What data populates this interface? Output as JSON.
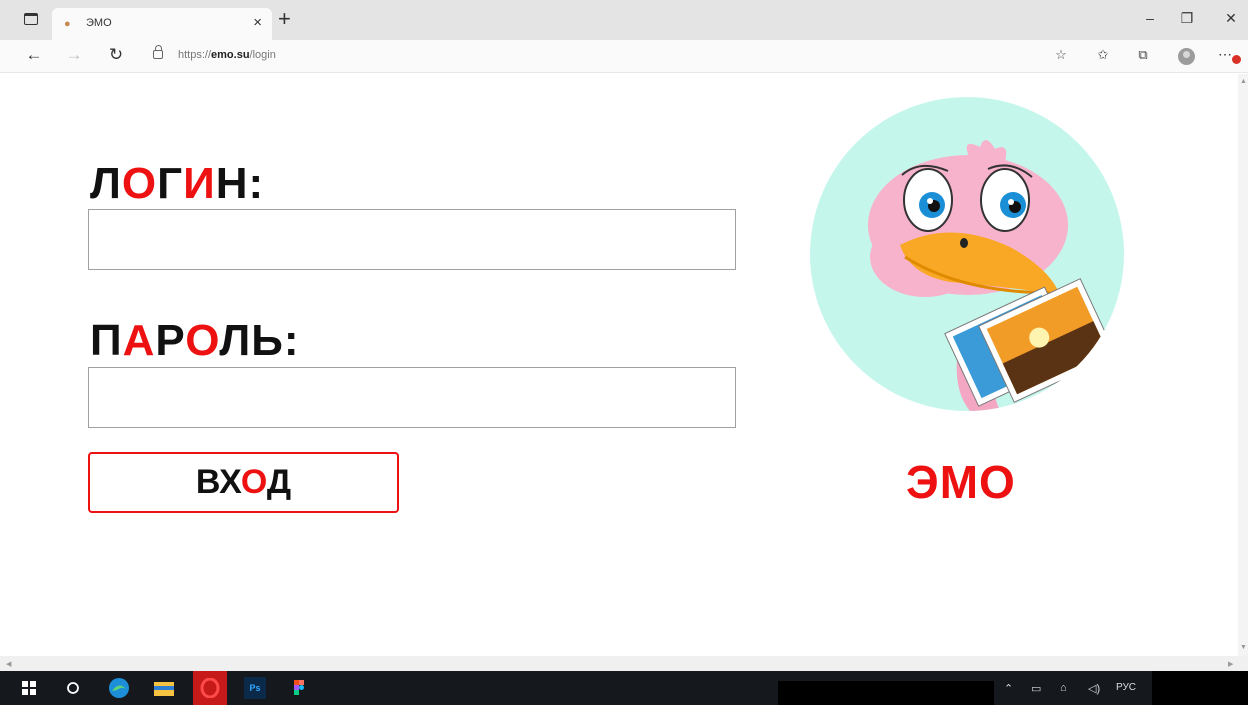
{
  "browser": {
    "tab": {
      "title": "ЭМО",
      "favicon": "paw-icon"
    },
    "address": {
      "scheme": "https://",
      "domain": "emo.su",
      "path": "/login"
    }
  },
  "form": {
    "login": {
      "label_parts": [
        "Л",
        "О",
        "Г",
        "И",
        "Н:"
      ],
      "value": ""
    },
    "password": {
      "label_parts": [
        "П",
        "А",
        "Р",
        "О",
        "ЛЬ:"
      ],
      "value": ""
    },
    "submit": {
      "label_parts": [
        "ВХ",
        "О",
        "Д"
      ]
    }
  },
  "brand": {
    "name_parts": [
      "ЭМ",
      "О"
    ]
  },
  "colors": {
    "accent": "#ee1111",
    "text": "#111111",
    "mascot_bg": "#c5f6ec"
  },
  "taskbar": {
    "apps": [
      "windows-start-icon",
      "search-icon",
      "edge-icon",
      "file-explorer-icon",
      "opera-icon",
      "photoshop-icon",
      "figma-icon"
    ],
    "photoshop_label": "Ps",
    "language": "РУС"
  }
}
